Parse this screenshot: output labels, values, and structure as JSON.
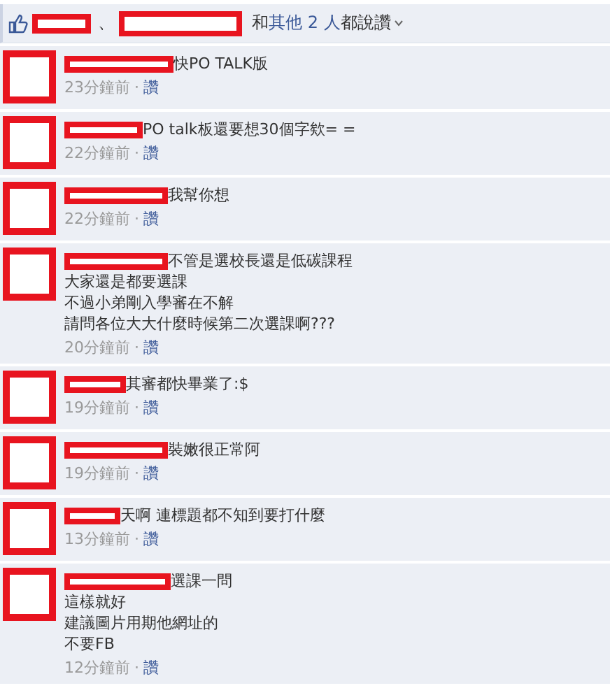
{
  "likes": {
    "joiner": "、",
    "before": "和",
    "link": "其他 2 人",
    "after": "都說讚"
  },
  "comments": [
    {
      "lines": [
        "快PO TALK版"
      ],
      "time": "23分鐘前",
      "separator": "·",
      "like": "讚"
    },
    {
      "lines": [
        "PO talk板還要想30個字欸= ="
      ],
      "time": "22分鐘前",
      "separator": "·",
      "like": "讚"
    },
    {
      "lines": [
        "我幫你想"
      ],
      "time": "22分鐘前",
      "separator": "·",
      "like": "讚"
    },
    {
      "lines": [
        "不管是選校長還是低碳課程",
        "大家還是都要選課",
        "不過小弟剛入學審在不解",
        "請問各位大大什麼時候第二次選課啊???"
      ],
      "time": "20分鐘前",
      "separator": "·",
      "like": "讚"
    },
    {
      "lines": [
        "其審都快畢業了:$"
      ],
      "time": "19分鐘前",
      "separator": "·",
      "like": "讚"
    },
    {
      "lines": [
        "裝嫩很正常阿"
      ],
      "time": "19分鐘前",
      "separator": "·",
      "like": "讚"
    },
    {
      "lines": [
        "天啊 連標題都不知到要打什麼"
      ],
      "time": "13分鐘前",
      "separator": "·",
      "like": "讚"
    },
    {
      "lines": [
        "選課一問",
        "這樣就好",
        "建議圖片用期他網址的",
        "不要FB"
      ],
      "time": "12分鐘前",
      "separator": "·",
      "like": "讚"
    }
  ]
}
